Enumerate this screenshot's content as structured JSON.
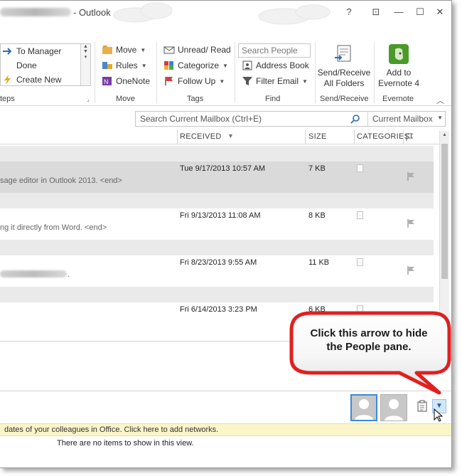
{
  "window": {
    "title": "- Outlook",
    "controls": [
      "?",
      "⊡",
      "—",
      "☐",
      "✕"
    ]
  },
  "ribbon": {
    "quick_steps": {
      "items": [
        "To Manager",
        "Done",
        "Create New"
      ],
      "group_label": "teps"
    },
    "move": {
      "items": [
        "Move",
        "Rules",
        "OneNote"
      ],
      "group_label": "Move"
    },
    "tags": {
      "items": [
        "Unread/ Read",
        "Categorize",
        "Follow Up"
      ],
      "group_label": "Tags"
    },
    "find": {
      "search_people_placeholder": "Search People",
      "items": [
        "Address Book",
        "Filter Email"
      ],
      "group_label": "Find"
    },
    "send_receive": {
      "button_label_1": "Send/Receive",
      "button_label_2": "All Folders",
      "group_label": "Send/Receive"
    },
    "evernote": {
      "button_label_1": "Add to",
      "button_label_2": "Evernote 4",
      "group_label": "Evernote"
    }
  },
  "search": {
    "placeholder": "Search Current Mailbox (Ctrl+E)",
    "scope": "Current Mailbox"
  },
  "columns": {
    "received": "RECEIVED",
    "size": "SIZE",
    "categories": "CATEGORIES"
  },
  "messages": [
    {
      "received": "Tue 9/17/2013 10:57 AM",
      "size": "7 KB",
      "preview": "sage editor in Outlook 2013. <end>",
      "selected": true
    },
    {
      "received": "Fri 9/13/2013 11:08 AM",
      "size": "8 KB",
      "preview": "ng it directly from Word. <end>",
      "selected": false
    },
    {
      "received": "Fri 8/23/2013 9:55 AM",
      "size": "11 KB",
      "preview": ".",
      "selected": false
    },
    {
      "received": "Fri 6/14/2013 3:23 PM",
      "size": "6 KB",
      "preview": "",
      "selected": false
    }
  ],
  "people_pane": {
    "info_bar": "dates of your colleagues in Office. Click here to add networks.",
    "empty_text": "There are no items to show in this view."
  },
  "callout": {
    "line1": "Click this arrow to hide",
    "line2": "the People pane."
  },
  "colors": {
    "accent": "#3c8ad8",
    "callout_red": "#e02020",
    "infobar": "#fbf6c9",
    "selected_row": "#dadada"
  }
}
